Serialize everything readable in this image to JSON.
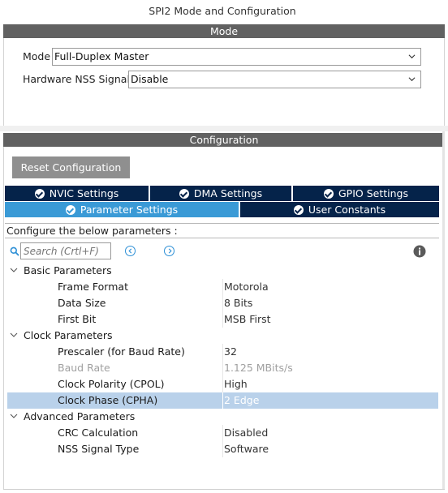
{
  "window": {
    "title": "SPI2 Mode and Configuration"
  },
  "mode_section": {
    "header": "Mode",
    "mode_label": "Mode",
    "mode_value": "Full-Duplex Master",
    "nss_label": "Hardware NSS Signal",
    "nss_value": "Disable"
  },
  "config_section": {
    "header": "Configuration",
    "reset_button": "Reset Configuration",
    "tabs_top": [
      {
        "label": "NVIC Settings",
        "active": false
      },
      {
        "label": "DMA Settings",
        "active": false
      },
      {
        "label": "GPIO Settings",
        "active": false
      }
    ],
    "tabs_bottom": [
      {
        "label": "Parameter Settings",
        "active": true
      },
      {
        "label": "User Constants",
        "active": false
      }
    ],
    "instruction": "Configure the below parameters :",
    "search_placeholder": "Search (Crtl+F)"
  },
  "param_groups": [
    {
      "name": "Basic Parameters",
      "params": [
        {
          "name": "Frame Format",
          "value": "Motorola"
        },
        {
          "name": "Data Size",
          "value": "8 Bits"
        },
        {
          "name": "First Bit",
          "value": "MSB First"
        }
      ]
    },
    {
      "name": "Clock Parameters",
      "params": [
        {
          "name": "Prescaler (for Baud Rate)",
          "value": "32"
        },
        {
          "name": "Baud Rate",
          "value": "1.125 MBits/s",
          "disabled": true
        },
        {
          "name": "Clock Polarity (CPOL)",
          "value": "High"
        },
        {
          "name": "Clock Phase (CPHA)",
          "value": "2 Edge",
          "selected": true
        }
      ]
    },
    {
      "name": "Advanced Parameters",
      "params": [
        {
          "name": "CRC Calculation",
          "value": "Disabled"
        },
        {
          "name": "NSS Signal Type",
          "value": "Software"
        }
      ]
    }
  ],
  "colors": {
    "section_header": "#616161",
    "tab_inactive": "#05234a",
    "tab_active": "#3a9ad6",
    "row_selected": "#b9d1ea",
    "icon_blue": "#2c8fd6"
  }
}
